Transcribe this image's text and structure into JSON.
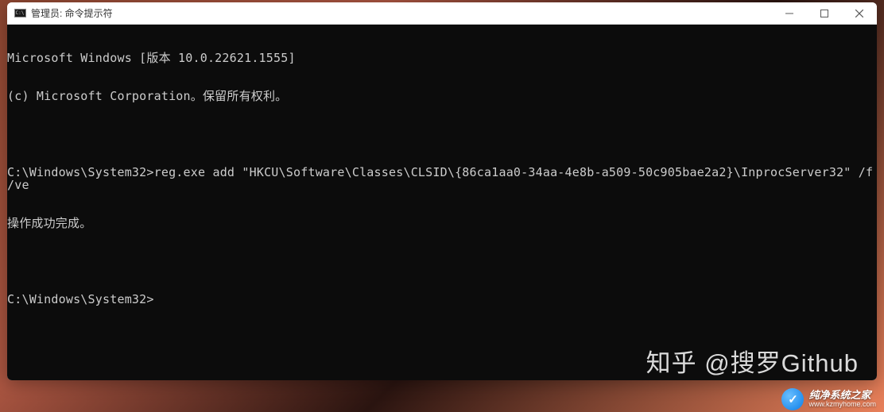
{
  "titlebar": {
    "title": "管理员: 命令提示符",
    "icon_glyph": "C:\\"
  },
  "terminal": {
    "line1": "Microsoft Windows [版本 10.0.22621.1555]",
    "line2": "(c) Microsoft Corporation。保留所有权利。",
    "line3": "C:\\Windows\\System32>reg.exe add \"HKCU\\Software\\Classes\\CLSID\\{86ca1aa0-34aa-4e8b-a509-50c905bae2a2}\\InprocServer32\" /f /ve",
    "line4": "操作成功完成。",
    "line5": "C:\\Windows\\System32>"
  },
  "watermarks": {
    "zhihu": "知乎 @搜罗Github",
    "brand_main": "纯净系统之家",
    "brand_sub": "www.kzmyhome.com",
    "brand_icon_glyph": "✓"
  }
}
